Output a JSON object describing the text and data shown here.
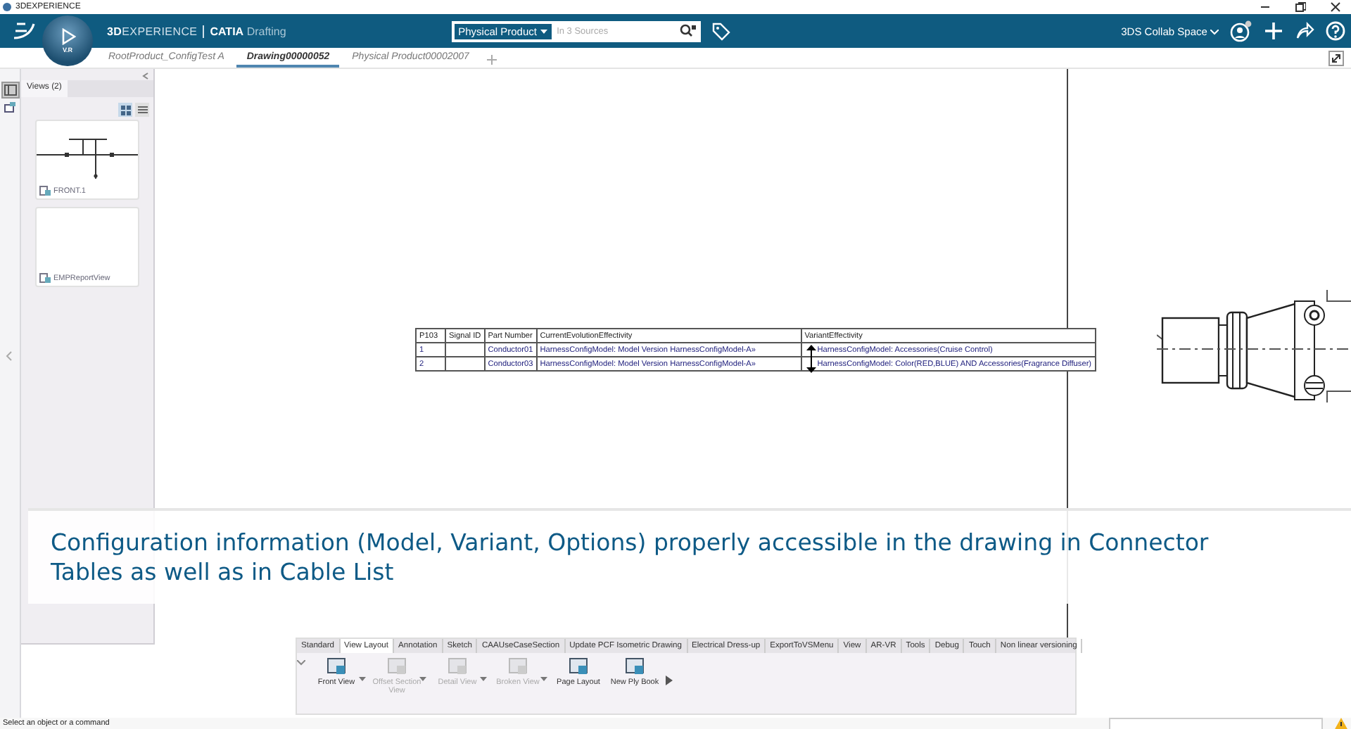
{
  "window": {
    "title": "3DEXPERIENCE"
  },
  "top_bar": {
    "brand": "3D",
    "brand_rest": "EXPERIENCE",
    "app": "CATIA",
    "module": "Drafting",
    "compass_label": "V.R",
    "search_scope": "Physical Product",
    "search_placeholder": "In 3 Sources",
    "collab_space": "3DS Collab Space"
  },
  "tabs": [
    {
      "label": "RootProduct_ConfigTest A",
      "selected": false
    },
    {
      "label": "Drawing00000052",
      "selected": true
    },
    {
      "label": "Physical Product00002007",
      "selected": false
    }
  ],
  "views_panel": {
    "title": "Views (2)",
    "grid_selected": true,
    "views": [
      {
        "label": "FRONT.1",
        "kind": "front"
      },
      {
        "label": "EMPReportView",
        "kind": "empty"
      }
    ]
  },
  "table": {
    "columns": [
      "P103",
      "Signal ID",
      "Part Number",
      "CurrentEvolutionEffectivity",
      "VariantEffectivity"
    ],
    "rows": [
      [
        "1",
        "",
        "Conductor01",
        "HarnessConfigModel: Model Version HarnessConfigModel-A»",
        "HarnessConfigModel: Accessories(Cruise Control)"
      ],
      [
        "2",
        "",
        "Conductor03",
        "HarnessConfigModel: Model Version HarnessConfigModel-A»",
        "HarnessConfigModel: Color(RED,BLUE) AND Accessories(Fragrance Diffuser)"
      ]
    ]
  },
  "caption": "Configuration information (Model, Variant, Options) properly accessible in the drawing in Connector Tables as well as in Cable List",
  "toolbar": {
    "tabs": [
      {
        "label": "Standard",
        "selected": false
      },
      {
        "label": "View Layout",
        "selected": true
      },
      {
        "label": "Annotation",
        "selected": false
      },
      {
        "label": "Sketch",
        "selected": false
      },
      {
        "label": "CAAUseCaseSection",
        "selected": false
      },
      {
        "label": "Update PCF Isometric Drawing",
        "selected": false
      },
      {
        "label": "Electrical Dress-up",
        "selected": false
      },
      {
        "label": "ExportToVSMenu",
        "selected": false
      },
      {
        "label": "View",
        "selected": false
      },
      {
        "label": "AR-VR",
        "selected": false
      },
      {
        "label": "Tools",
        "selected": false
      },
      {
        "label": "Debug",
        "selected": false
      },
      {
        "label": "Touch",
        "selected": false
      },
      {
        "label": "Non linear versioning",
        "selected": false
      }
    ],
    "tools": [
      {
        "label": "Front View",
        "disabled": false,
        "dropdown": true
      },
      {
        "label": "Offset Section View",
        "disabled": true,
        "dropdown": true
      },
      {
        "label": "Detail View",
        "disabled": true,
        "dropdown": true
      },
      {
        "label": "Broken View",
        "disabled": true,
        "dropdown": true
      },
      {
        "label": "Page Layout",
        "disabled": false,
        "dropdown": false
      },
      {
        "label": "New Ply Book",
        "disabled": false,
        "dropdown": false
      }
    ]
  },
  "status_bar": {
    "text": "Select an object or a command"
  }
}
